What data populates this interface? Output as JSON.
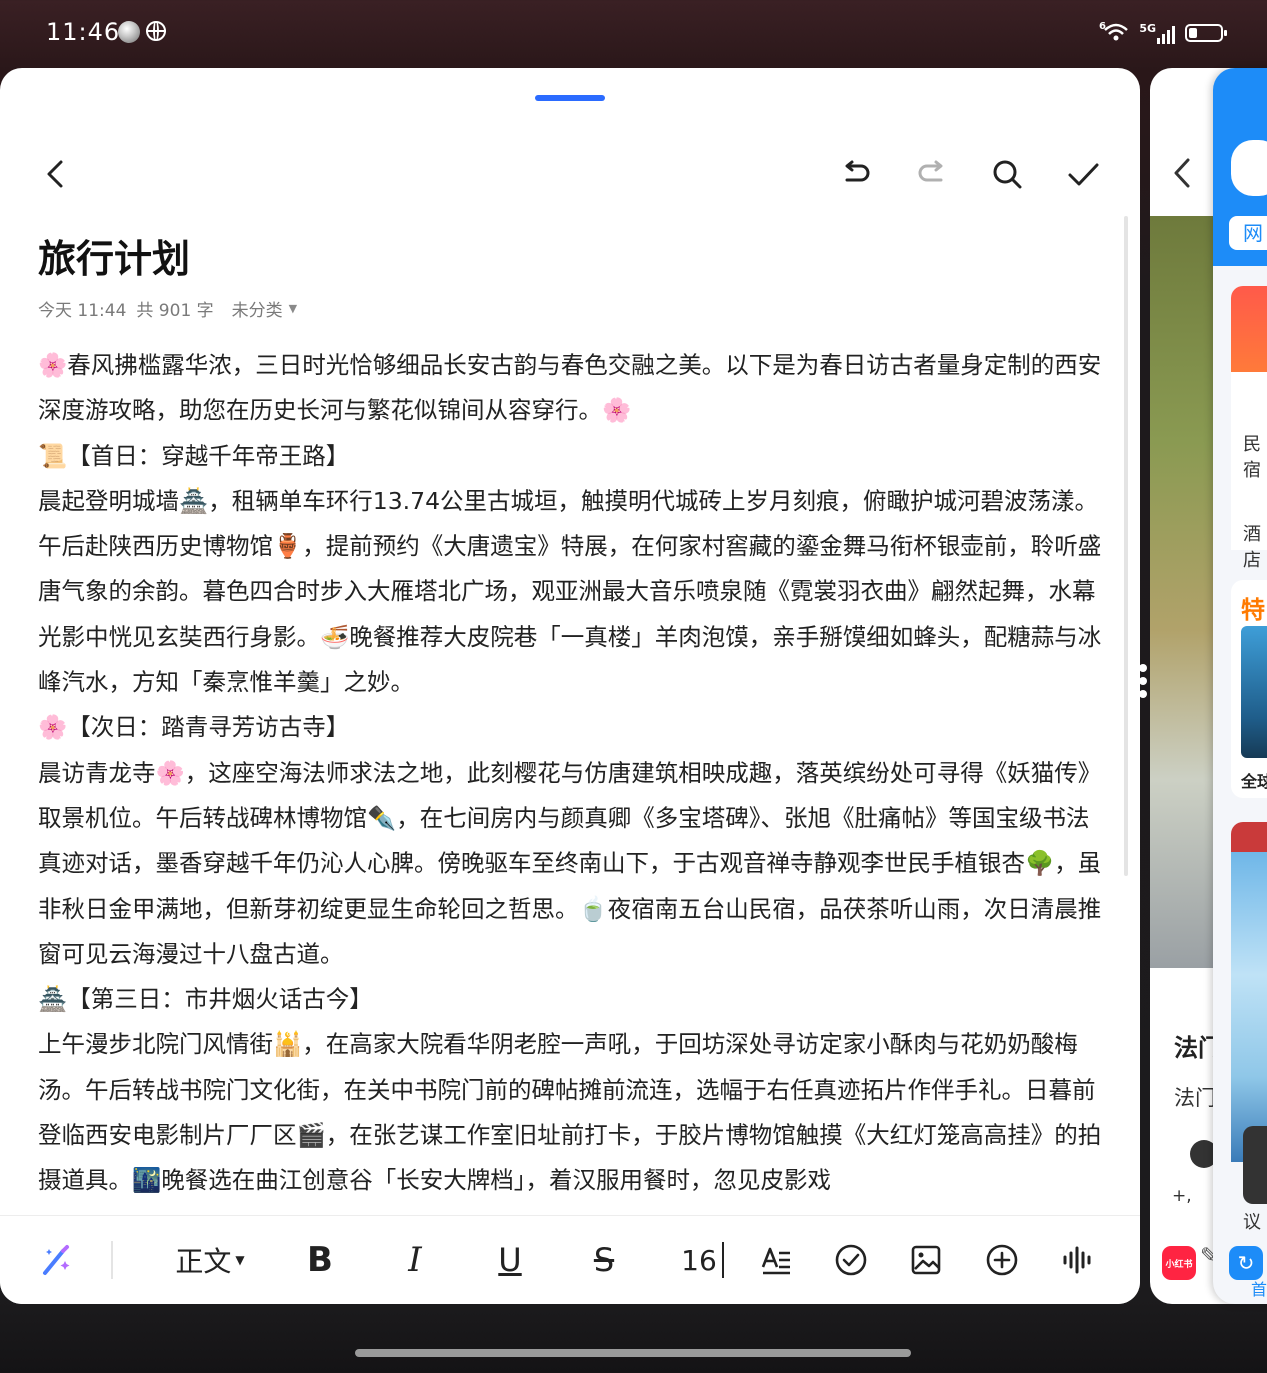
{
  "status_bar": {
    "time": "11:46",
    "network": "5G",
    "wifi_label": "6"
  },
  "note": {
    "title": "旅行计划",
    "meta_time": "今天 11:44",
    "meta_count": "共 901 字",
    "meta_category": "未分类",
    "paragraphs": [
      "🌸春风拂槛露华浓，三日时光恰够细品长安古韵与春色交融之美。以下是为春日访古者量身定制的西安深度游攻略，助您在历史长河与繁花似锦间从容穿行。🌸",
      "📜【首日：穿越千年帝王路】",
      "晨起登明城墙🏯，租辆单车环行13.74公里古城垣，触摸明代城砖上岁月刻痕，俯瞰护城河碧波荡漾。午后赴陕西历史博物馆🏺，提前预约《大唐遗宝》特展，在何家村窖藏的鎏金舞马衔杯银壶前，聆听盛唐气象的余韵。暮色四合时步入大雁塔北广场，观亚洲最大音乐喷泉随《霓裳羽衣曲》翩然起舞，水幕光影中恍见玄奘西行身影。🍜晚餐推荐大皮院巷「一真楼」羊肉泡馍，亲手掰馍细如蜂头，配糖蒜与冰峰汽水，方知「秦烹惟羊羹」之妙。",
      "🌸【次日：踏青寻芳访古寺】",
      "晨访青龙寺🌸，这座空海法师求法之地，此刻樱花与仿唐建筑相映成趣，落英缤纷处可寻得《妖猫传》取景机位。午后转战碑林博物馆✒️，在七间房内与颜真卿《多宝塔碑》、张旭《肚痛帖》等国宝级书法真迹对话，墨香穿越千年仍沁人心脾。傍晚驱车至终南山下，于古观音禅寺静观李世民手植银杏🌳，虽非秋日金甲满地，但新芽初绽更显生命轮回之哲思。🍵夜宿南五台山民宿，品茯茶听山雨，次日清晨推窗可见云海漫过十八盘古道。",
      "🏯【第三日：市井烟火话古今】",
      "上午漫步北院门风情街🕌，在高家大院看华阴老腔一声吼，于回坊深处寻访定家小酥肉与花奶奶酸梅汤。午后转战书院门文化街，在关中书院门前的碑帖摊前流连，选幅于右任真迹拓片作伴手礼。日暮前登临西安电影制片厂厂区🎬，在张艺谋工作室旧址前打卡，于胶片博物馆触摸《大红灯笼高高挂》的拍摄道具。🌃晚餐选在曲江创意谷「长安大牌档」，着汉服用餐时，忽见皮影戏"
    ]
  },
  "toolbar": {
    "style_label": "正文",
    "bold": "B",
    "italic": "I",
    "underline": "U",
    "strike": "S",
    "font_size": "16"
  },
  "side_app": {
    "text1": "法门",
    "text2": "法门",
    "text3": "️+,",
    "app_badge": "小红书"
  },
  "far_app": {
    "chip_text": "网",
    "text1": "民宿",
    "text2": "酒店",
    "text3": "特",
    "text4": "全球",
    "text5": "议",
    "text6": "首"
  },
  "colors": {
    "accent": "#2b6bff",
    "background": "#1c1b1d",
    "card": "#ffffff"
  }
}
